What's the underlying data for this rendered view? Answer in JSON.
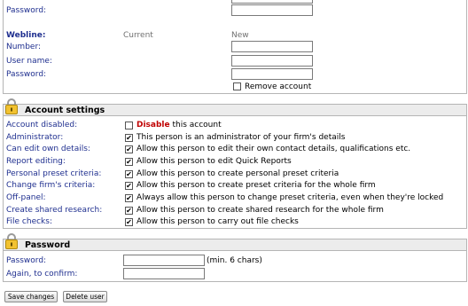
{
  "top": {
    "password_label": "Password:"
  },
  "webline": {
    "heading": "Webline:",
    "col_current": "Current",
    "col_new": "New",
    "number_label": "Number:",
    "username_label": "User name:",
    "password_label": "Password:",
    "remove_account_label": "Remove account",
    "remove_account_checked": false
  },
  "account_settings": {
    "title": "Account settings",
    "rows": [
      {
        "label": "Account disabled:",
        "text_prefix": "Disable",
        "text": " this account",
        "checked": false
      },
      {
        "label": "Administrator:",
        "text_prefix": "",
        "text": "This person is an administrator of your firm's details",
        "checked": true
      },
      {
        "label": "Can edit own details:",
        "text_prefix": "",
        "text": "Allow this person to edit their own contact details, qualifications etc.",
        "checked": true
      },
      {
        "label": "Report editing:",
        "text_prefix": "",
        "text": "Allow this person to edit Quick Reports",
        "checked": true
      },
      {
        "label": "Personal preset criteria:",
        "text_prefix": "",
        "text": "Allow this person to create personal preset criteria",
        "checked": true
      },
      {
        "label": "Change firm's criteria:",
        "text_prefix": "",
        "text": "Allow this person to create preset criteria for the whole firm",
        "checked": true
      },
      {
        "label": "Off-panel:",
        "text_prefix": "",
        "text": "Always allow this person to change preset criteria, even when they're locked",
        "checked": true
      },
      {
        "label": "Create shared research:",
        "text_prefix": "",
        "text": "Allow this person to create shared research for the whole firm",
        "checked": true
      },
      {
        "label": "File checks:",
        "text_prefix": "",
        "text": "Allow this person to carry out file checks",
        "checked": true
      }
    ]
  },
  "password_panel": {
    "title": "Password",
    "password_label": "Password:",
    "password_hint": "(min. 6 chars)",
    "confirm_label": "Again, to confirm:"
  },
  "buttons": {
    "save": "Save changes",
    "delete": "Delete user"
  },
  "icons": {
    "lock": "padlock-icon",
    "check": "checkmark-icon"
  }
}
